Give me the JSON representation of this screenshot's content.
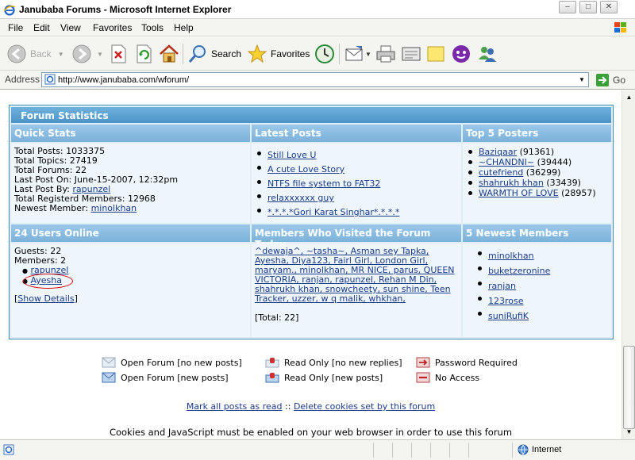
{
  "window": {
    "title": "Janubaba Forums - Microsoft Internet Explorer"
  },
  "menu": [
    "File",
    "Edit",
    "View",
    "Favorites",
    "Tools",
    "Help"
  ],
  "toolbar": {
    "back": "Back",
    "search": "Search",
    "favorites": "Favorites"
  },
  "address": {
    "label": "Address",
    "url": "http://www.janubaba.com/wforum/",
    "go": "Go"
  },
  "stats": {
    "title": "Forum Statistics",
    "quick_stats": {
      "heading": "Quick Stats",
      "total_posts": "Total Posts: 1033375",
      "total_topics": "Total Topics: 27419",
      "total_forums": "Total Forums: 22",
      "last_post_on": "Last Post On: June-15-2007, 12:32pm",
      "last_post_by_label": "Last Post By: ",
      "last_post_by": "rapunzel",
      "registered": "Total Registerd Members: 12968",
      "newest_label": "Newest Member: ",
      "newest": "minolkhan"
    },
    "latest_posts": {
      "heading": "Latest Posts",
      "items": [
        "Still Love U",
        "A cute Love Story",
        "NTFS file system to FAT32",
        "relaxxxxxx guy",
        "*.*.*.*Gori Karat Singhar*.*.*.*"
      ]
    },
    "top_posters": {
      "heading": "Top 5 Posters",
      "items": [
        {
          "name": "Baziqaar",
          "count": "(91361)"
        },
        {
          "name": "~CHANDNI~",
          "count": "(39444)"
        },
        {
          "name": "cutefriend",
          "count": "(36299)"
        },
        {
          "name": "shahrukh khan",
          "count": "(33439)"
        },
        {
          "name": "WARMTH OF LOVE",
          "count": "(28957)"
        }
      ]
    },
    "users_online": {
      "heading": "24 Users Online",
      "guests": "Guests: 22",
      "members": "Members: 2",
      "names": [
        "rapunzel",
        "Ayesha"
      ],
      "show_details": "Show Details"
    },
    "visited_today": {
      "heading": "Members Who Visited the Forum Today",
      "lines": [
        "^dewaja^, ~tasha~, Asman sey Tapka,",
        "Ayesha, Diya123, Fairl Girl, London Girl,",
        "maryam., minolkhan, MR NICE, parus, QUEEN",
        "VICTORIA, ranjan, rapunzel, Rehan M Din,",
        "shahrukh khan, snowcheety, sun shine, Teen",
        "Tracker, uzzer, w q malik, whkhan,"
      ],
      "total": "[Total: 22]"
    },
    "newest_members": {
      "heading": "5 Newest Members",
      "items": [
        "minolkhan",
        "buketzeronine",
        "ranjan",
        "123rose",
        "suniRufiK"
      ]
    }
  },
  "legend": {
    "open_no_new": "Open Forum [no new posts]",
    "open_new": "Open Forum [new posts]",
    "ro_no_new": "Read Only [no new replies]",
    "ro_new": "Read Only [new posts]",
    "password": "Password Required",
    "no_access": "No Access"
  },
  "footer": {
    "mark_read": "Mark all posts as read",
    "separator": "::",
    "delete_cookies": "Delete cookies set by this forum",
    "notice": "Cookies and JavaScript must be enabled on your web browser in order to use this forum"
  },
  "status": {
    "zone": "Internet"
  },
  "colors": {
    "header_blue": "#4c93c5",
    "section_blue": "#7cb2da",
    "cell_bg": "#eff6fb",
    "link": "#1a3a8a",
    "circle": "#d00000"
  }
}
